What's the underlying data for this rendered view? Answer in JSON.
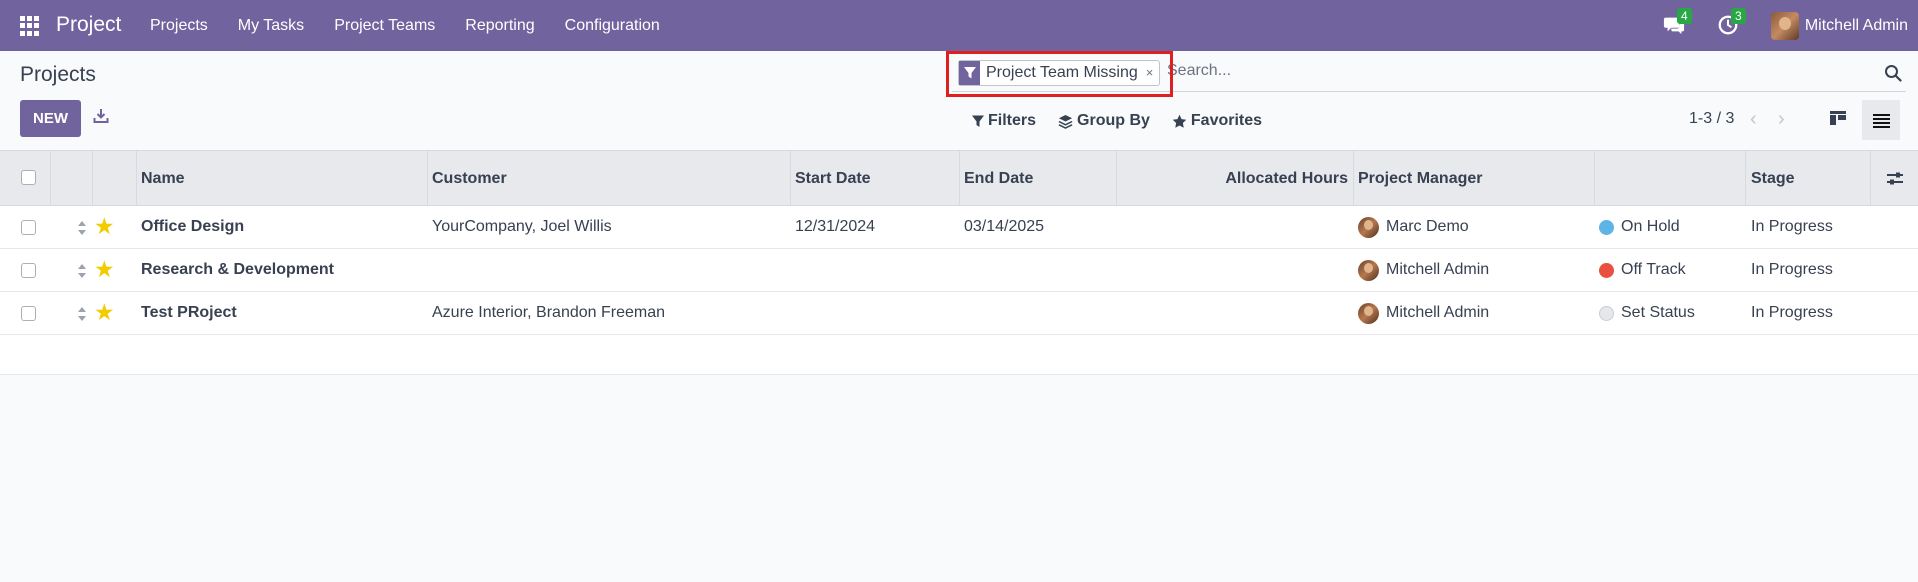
{
  "navbar": {
    "brand": "Project",
    "menu": [
      "Projects",
      "My Tasks",
      "Project Teams",
      "Reporting",
      "Configuration"
    ],
    "messages_count": "4",
    "activities_count": "3",
    "user_name": "Mitchell Admin",
    "color": "#71639e"
  },
  "control_panel": {
    "title": "Projects",
    "new_label": "NEW",
    "facet_label": "Project Team Missing",
    "facet_close": "×",
    "search_placeholder": "Search...",
    "filters_label": "Filters",
    "group_by_label": "Group By",
    "favorites_label": "Favorites",
    "pager_value": "1-3 / 3"
  },
  "table": {
    "headers": {
      "name": "Name",
      "customer": "Customer",
      "start_date": "Start Date",
      "end_date": "End Date",
      "allocated_hours": "Allocated Hours",
      "project_manager": "Project Manager",
      "stage": "Stage"
    },
    "rows": [
      {
        "name": "Office Design",
        "customer": "YourCompany, Joel Willis",
        "start_date": "12/31/2024",
        "end_date": "03/14/2025",
        "manager": "Marc Demo",
        "status": "On Hold",
        "status_color": "#5fb4e6",
        "stage": "In Progress"
      },
      {
        "name": "Research & Development",
        "customer": "",
        "start_date": "",
        "end_date": "",
        "manager": "Mitchell Admin",
        "status": "Off Track",
        "status_color": "#e8513f",
        "stage": "In Progress"
      },
      {
        "name": "Test PRoject",
        "customer": "Azure Interior, Brandon Freeman",
        "start_date": "",
        "end_date": "",
        "manager": "Mitchell Admin",
        "status": "Set Status",
        "status_color": "#e5e7eb",
        "stage": "In Progress"
      }
    ]
  }
}
